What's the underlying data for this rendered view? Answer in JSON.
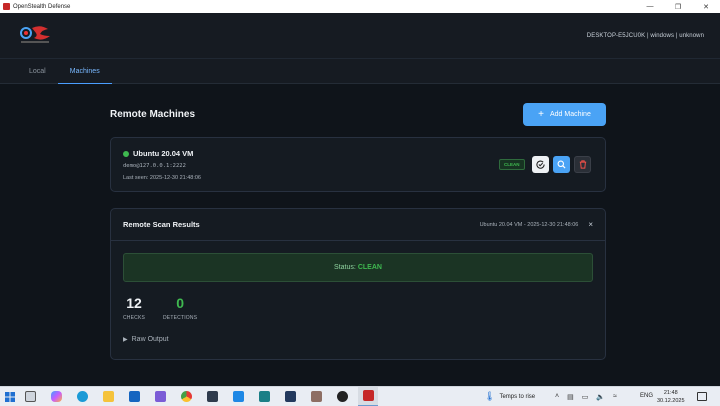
{
  "window": {
    "title": "OpenStealth Defense",
    "controls": [
      "minimize",
      "maximize",
      "close"
    ]
  },
  "header": {
    "logo_icon": "openstealth-logo-icon",
    "host_info": "DESKTOP-E5JCU0K | windows | unknown"
  },
  "tabs": [
    {
      "label": "Local",
      "active": false
    },
    {
      "label": "Machines",
      "active": true
    }
  ],
  "page": {
    "title": "Remote Machines",
    "add_button_label": "Add Machine",
    "add_button_icon": "plus-icon"
  },
  "machine": {
    "name": "Ubuntu 20.04 VM",
    "address": "demo@127.0.0.1:2222",
    "last_seen": "Last seen: 2025-12-30 21:48:06",
    "status_badge": "CLEAN",
    "online_color": "#3fb950",
    "actions": [
      "scan-icon",
      "search-icon",
      "trash-icon"
    ]
  },
  "results": {
    "title": "Remote Scan Results",
    "subtitle": "Ubuntu 20.04 VM - 2025-12-30 21:48:06",
    "close_label": "×",
    "status_prefix": "Status:",
    "status_value": "CLEAN",
    "checks_value": "12",
    "checks_label": "CHECKS",
    "detections_value": "0",
    "detections_label": "DETECTIONS",
    "raw_output_label": "Raw Output"
  },
  "taskbar": {
    "weather_text": "Temps to rise",
    "language": "ENG",
    "time": "21:48",
    "date": "30.12.2025",
    "apps": [
      "windows-start-icon",
      "task-view-icon",
      "copilot-icon",
      "edge-icon",
      "file-explorer-icon",
      "mail-icon",
      "teams-icon",
      "chrome-icon",
      "git-icon",
      "vscode-icon",
      "visual-studio-icon",
      "powershell-icon",
      "game-icon",
      "obs-icon",
      "openstealth-app-icon"
    ]
  },
  "colors": {
    "accent": "#4aa3f5",
    "success": "#3fb950",
    "danger": "#f85149",
    "background": "#0f141a",
    "card": "#151b22"
  }
}
